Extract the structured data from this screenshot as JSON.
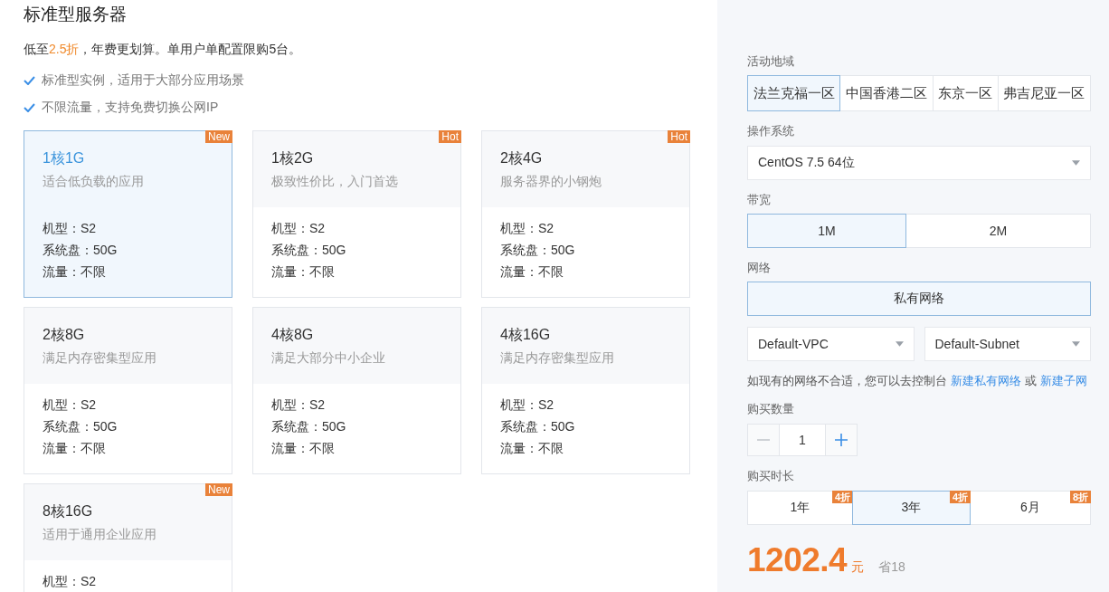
{
  "title": "标准型服务器",
  "promo": {
    "text_before": "低至",
    "highlighted": "2.5折",
    "text_after": "，年费更划算。单用户单配置限购5台。"
  },
  "features": [
    "标准型实例，适用于大部分应用场景",
    "不限流量，支持免费切换公网IP"
  ],
  "plans": [
    {
      "name": "1核1G",
      "description": "适合低负载的应用",
      "specs": [
        "机型：S2",
        "系统盘：50G",
        "流量：不限"
      ],
      "badge": "New",
      "selected": true
    },
    {
      "name": "1核2G",
      "description": "极致性价比，入门首选",
      "specs": [
        "机型：S2",
        "系统盘：50G",
        "流量：不限"
      ],
      "badge": "Hot",
      "selected": false
    },
    {
      "name": "2核4G",
      "description": "服务器界的小钢炮",
      "specs": [
        "机型：S2",
        "系统盘：50G",
        "流量：不限"
      ],
      "badge": "Hot",
      "selected": false
    },
    {
      "name": "2核8G",
      "description": "满足内存密集型应用",
      "specs": [
        "机型：S2",
        "系统盘：50G",
        "流量：不限"
      ],
      "selected": false
    },
    {
      "name": "4核8G",
      "description": "满足大部分中小企业",
      "specs": [
        "机型：S2",
        "系统盘：50G",
        "流量：不限"
      ],
      "selected": false
    },
    {
      "name": "4核16G",
      "description": "满足内存密集型应用",
      "specs": [
        "机型：S2",
        "系统盘：50G",
        "流量：不限"
      ],
      "selected": false
    },
    {
      "name": "8核16G",
      "description": "适用于通用企业应用",
      "specs": [
        "机型：S2"
      ],
      "badge": "New",
      "selected": false
    }
  ],
  "order": {
    "region": {
      "label": "活动地域",
      "options": [
        {
          "label": "法兰克福一区",
          "selected": true
        },
        {
          "label": "中国香港二区",
          "selected": false
        },
        {
          "label": "东京一区",
          "selected": false
        },
        {
          "label": "弗吉尼亚一区",
          "selected": false
        }
      ]
    },
    "os": {
      "label": "操作系统",
      "value": "CentOS 7.5 64位"
    },
    "bandwidth": {
      "label": "带宽",
      "options": [
        {
          "label": "1M",
          "selected": true
        },
        {
          "label": "2M",
          "selected": false
        }
      ]
    },
    "network": {
      "label": "网络",
      "options": [
        {
          "label": "私有网络",
          "selected": true
        }
      ],
      "vpc": "Default-VPC",
      "subnet": "Default-Subnet",
      "hint": {
        "text": "如现有的网络不合适，您可以去控制台",
        "links": [
          "新建私有网络",
          "新建子网"
        ],
        "separator": "或"
      }
    },
    "quantity": {
      "label": "购买数量",
      "value": "1",
      "decrement_disabled": true
    },
    "duration": {
      "label": "购买时长",
      "options": [
        {
          "label": "1年",
          "discount": "4折",
          "selected": false
        },
        {
          "label": "3年",
          "discount": "4折",
          "selected": true
        },
        {
          "label": "6月",
          "discount": "8折",
          "selected": false
        }
      ]
    },
    "price": {
      "amount": "1202.4",
      "unit": "元",
      "saving": "省18"
    }
  }
}
